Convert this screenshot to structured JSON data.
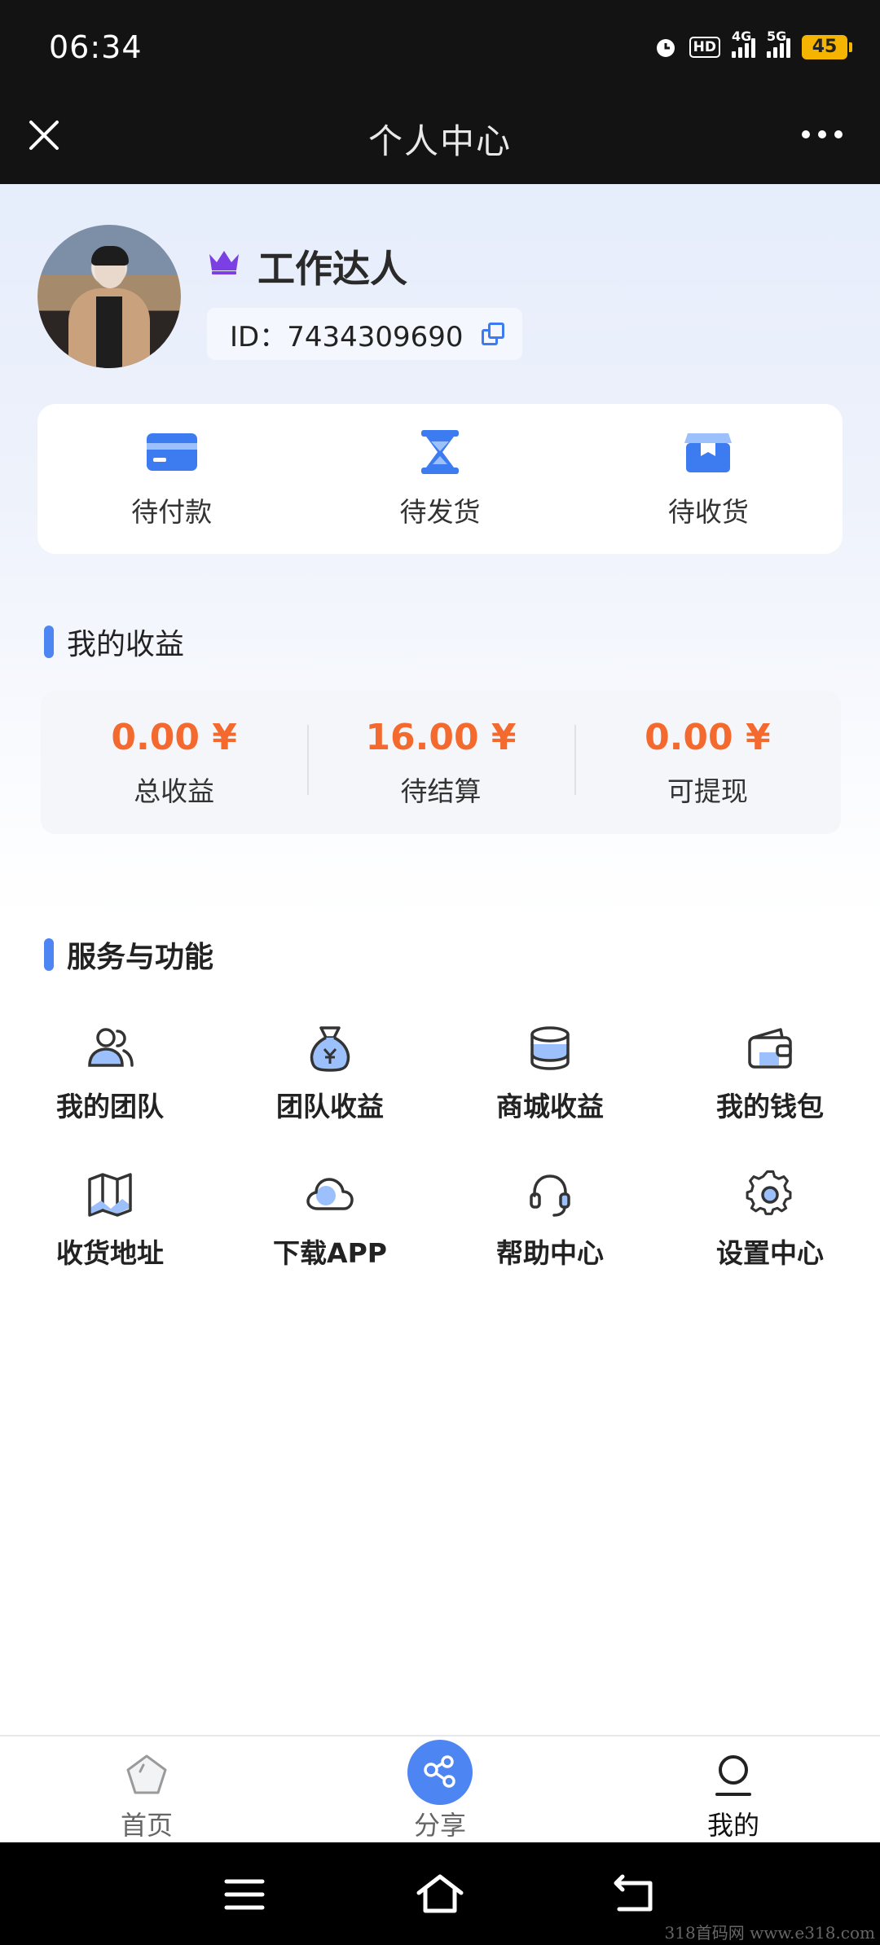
{
  "status_bar": {
    "time": "06:34",
    "battery": "45",
    "hd_label": "HD",
    "network_1": "4G",
    "network_2": "5G"
  },
  "top_bar": {
    "title": "个人中心",
    "close_icon": "close-icon",
    "more_icon": "more-icon"
  },
  "profile": {
    "username": "工作达人",
    "id_text": "ID：7434309690",
    "badge_icon": "crown-icon"
  },
  "orders": [
    {
      "label": "待付款",
      "icon": "card-icon"
    },
    {
      "label": "待发货",
      "icon": "hourglass-icon"
    },
    {
      "label": "待收货",
      "icon": "box-icon"
    }
  ],
  "earnings": {
    "title": "我的收益",
    "items": [
      {
        "value": "0.00 ¥",
        "label": "总收益"
      },
      {
        "value": "16.00 ¥",
        "label": "待结算"
      },
      {
        "value": "0.00 ¥",
        "label": "可提现"
      }
    ]
  },
  "services": {
    "title": "服务与功能",
    "items": [
      {
        "label": "我的团队",
        "icon": "team-icon"
      },
      {
        "label": "团队收益",
        "icon": "money-bag-icon"
      },
      {
        "label": "商城收益",
        "icon": "coins-icon"
      },
      {
        "label": "我的钱包",
        "icon": "wallet-icon"
      },
      {
        "label": "收货地址",
        "icon": "map-icon"
      },
      {
        "label": "下载APP",
        "icon": "cloud-icon"
      },
      {
        "label": "帮助中心",
        "icon": "headset-icon"
      },
      {
        "label": "设置中心",
        "icon": "gear-icon"
      }
    ]
  },
  "bottom_nav": [
    {
      "label": "首页",
      "icon": "home-pentagon-icon",
      "active": false
    },
    {
      "label": "分享",
      "icon": "share-icon",
      "active": false
    },
    {
      "label": "我的",
      "icon": "user-icon",
      "active": true
    }
  ],
  "watermark": "318首码网 www.e318.com",
  "colors": {
    "accent": "#4d85f2",
    "earning_value": "#f46a2e",
    "dark_bar": "#131313"
  }
}
